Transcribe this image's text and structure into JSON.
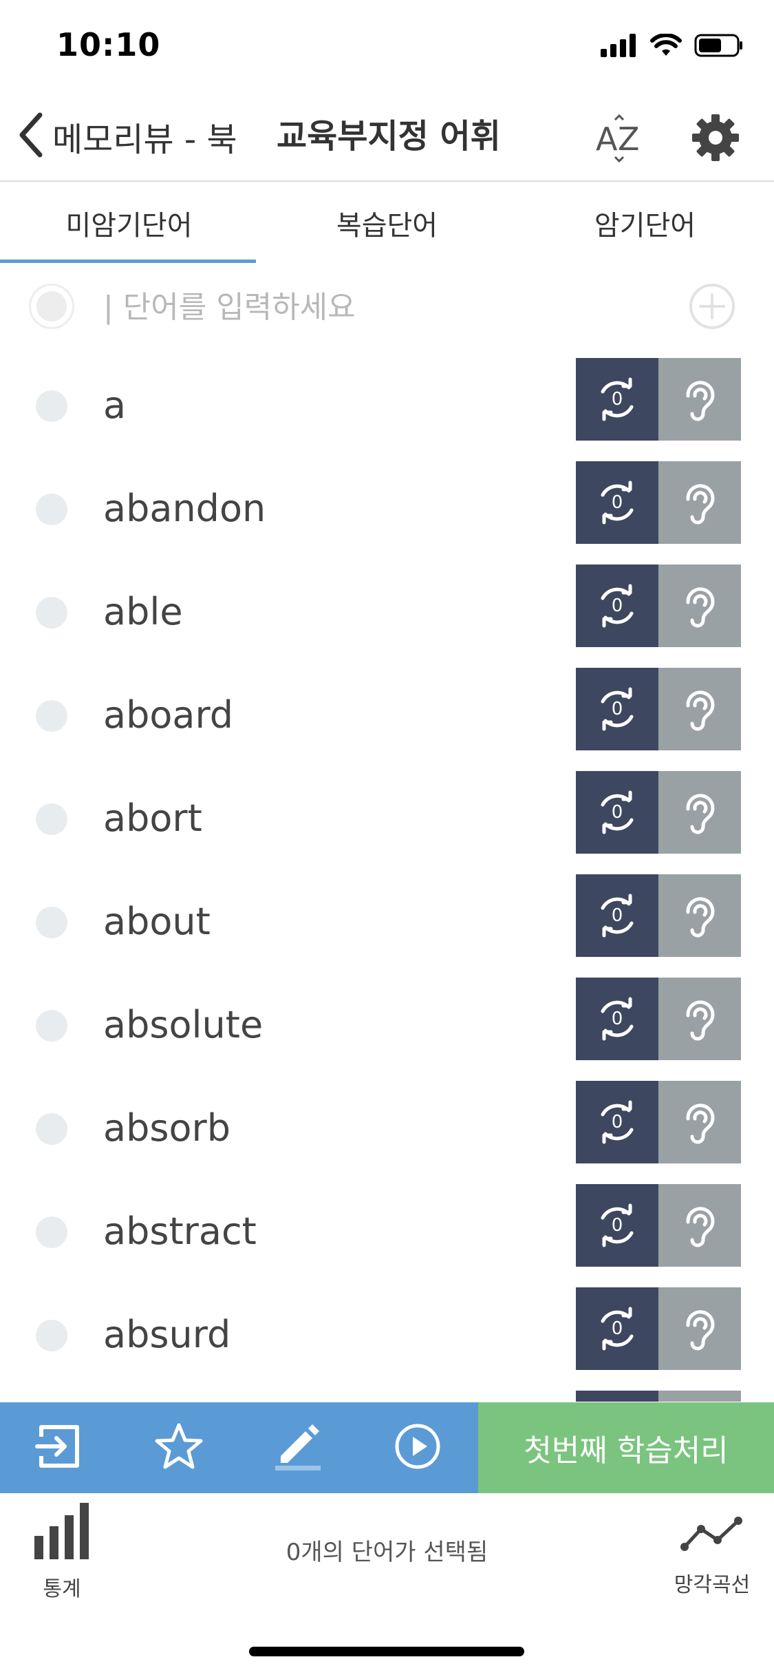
{
  "status_bar": {
    "time": "10:10"
  },
  "nav": {
    "back_label": "메모리뷰 - 북",
    "title": "교육부지정 어휘"
  },
  "tabs": [
    {
      "label": "미암기단어",
      "active": true
    },
    {
      "label": "복습단어",
      "active": false
    },
    {
      "label": "암기단어",
      "active": false
    }
  ],
  "input": {
    "placeholder": "| 단어를 입력하세요",
    "value": ""
  },
  "words": [
    {
      "word": "a",
      "review_count": "0"
    },
    {
      "word": "abandon",
      "review_count": "0"
    },
    {
      "word": "able",
      "review_count": "0"
    },
    {
      "word": "aboard",
      "review_count": "0"
    },
    {
      "word": "abort",
      "review_count": "0"
    },
    {
      "word": "about",
      "review_count": "0"
    },
    {
      "word": "absolute",
      "review_count": "0"
    },
    {
      "word": "absorb",
      "review_count": "0"
    },
    {
      "word": "abstract",
      "review_count": "0"
    },
    {
      "word": "absurd",
      "review_count": "0"
    },
    {
      "word": "",
      "review_count": ""
    }
  ],
  "action_bar": {
    "icons": [
      "login-icon",
      "star-icon",
      "pencil-icon",
      "play-icon"
    ],
    "first_study_label": "첫번째 학습처리"
  },
  "bottom_bar": {
    "stats_label": "통계",
    "selected_text": "0개의 단어가 선택됨",
    "curve_label": "망각곡선"
  },
  "colors": {
    "accent_blue": "#5b9bd5",
    "action_green": "#7bc47f",
    "review_dark": "#3d4760",
    "listen_gray": "#9aa1a5"
  }
}
